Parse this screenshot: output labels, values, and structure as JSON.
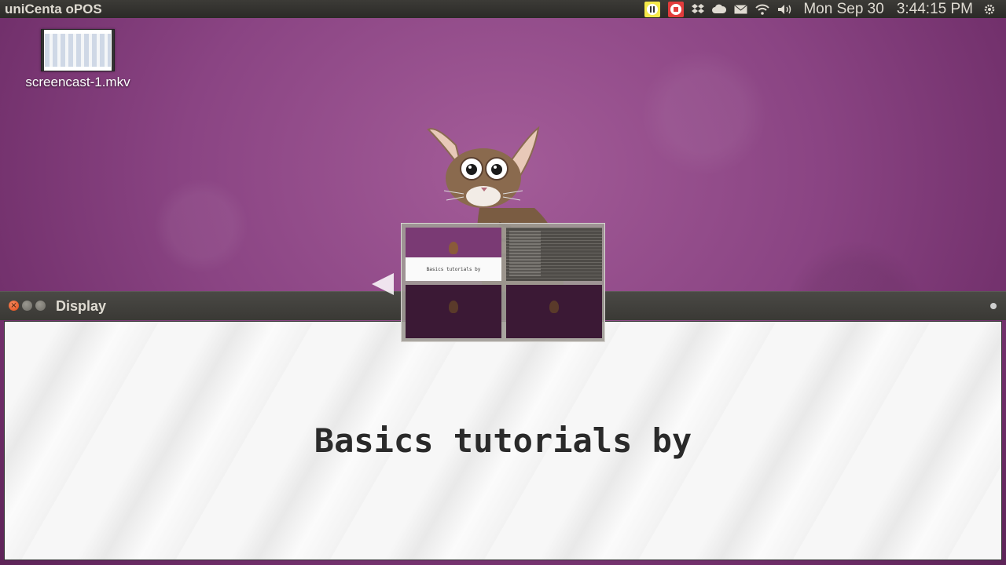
{
  "top_panel": {
    "app_title": "uniCenta oPOS",
    "indicators": [
      {
        "icon": "pause-icon"
      },
      {
        "icon": "record-stop-icon"
      },
      {
        "icon": "dropbox-icon"
      },
      {
        "icon": "cloud-icon"
      },
      {
        "icon": "mail-icon"
      },
      {
        "icon": "wifi-icon"
      },
      {
        "icon": "volume-icon"
      }
    ],
    "date": "Mon Sep 30",
    "time": "3:44:15 PM",
    "session_icon": "gear-icon"
  },
  "desktop": {
    "icons": [
      {
        "label": "screencast-1.mkv",
        "icon": "video-file-icon"
      }
    ]
  },
  "window": {
    "title": "Display",
    "content_text": "Basics tutorials by"
  },
  "workspace_switcher": {
    "workspaces": [
      {
        "preview_text": "Basics tutorials by"
      },
      {
        "preview_text": ""
      },
      {
        "preview_text": ""
      },
      {
        "preview_text": ""
      }
    ]
  }
}
